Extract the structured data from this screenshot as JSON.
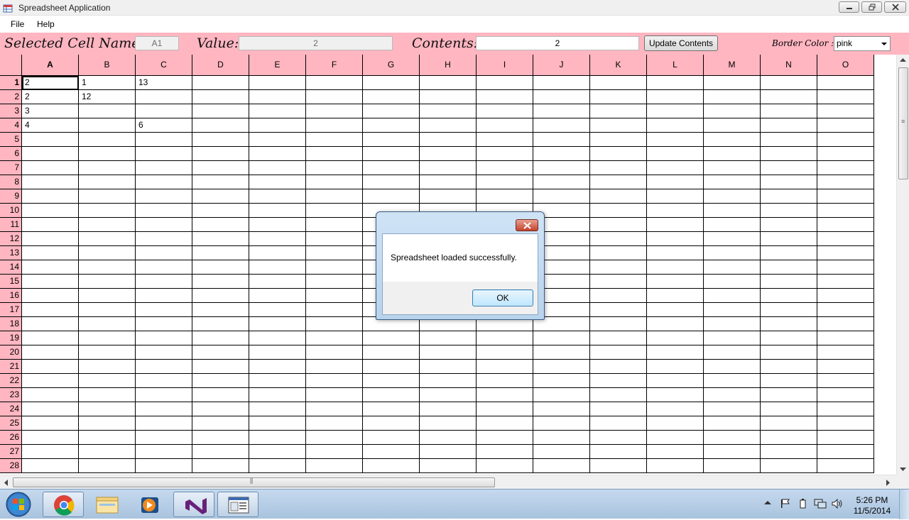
{
  "window": {
    "title": "Spreadsheet Application"
  },
  "menu": {
    "file": "File",
    "help": "Help"
  },
  "toolbar": {
    "selected_cell_label": "Selected Cell Name:",
    "selected_cell_value": "A1",
    "value_label": "Value:",
    "value_value": "2",
    "contents_label": "Contents:",
    "contents_value": "2",
    "update_button": "Update Contents",
    "border_color_label": "Border Color :)",
    "border_color_selected": "pink",
    "accent_color": "#ffb6c1"
  },
  "grid": {
    "columns": [
      "A",
      "B",
      "C",
      "D",
      "E",
      "F",
      "G",
      "H",
      "I",
      "J",
      "K",
      "L",
      "M",
      "N",
      "O"
    ],
    "rows": [
      "1",
      "2",
      "3",
      "4",
      "5",
      "6",
      "7",
      "8",
      "9",
      "10",
      "11",
      "12",
      "13",
      "14",
      "15",
      "16",
      "17",
      "18",
      "19",
      "20",
      "21",
      "22",
      "23",
      "24",
      "25",
      "26",
      "27",
      "28"
    ],
    "selected_cell": "A1",
    "cells": {
      "A1": "2",
      "B1": "1",
      "C1": "13",
      "A2": "2",
      "B2": "12",
      "A3": "3",
      "A4": "4",
      "C4": "6"
    }
  },
  "dialog": {
    "message": "Spreadsheet loaded successfully.",
    "ok": "OK"
  },
  "taskbar": {
    "time": "5:26 PM",
    "date": "11/5/2014",
    "apps": [
      "chrome-icon",
      "file-explorer-icon",
      "media-player-icon",
      "visual-studio-icon",
      "spreadsheet-app-icon"
    ]
  }
}
